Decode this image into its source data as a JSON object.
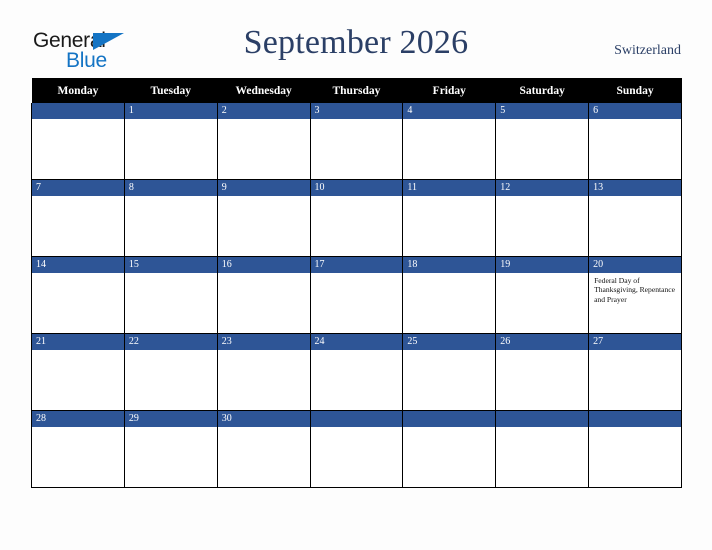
{
  "logo": {
    "text_primary": "General",
    "text_secondary": "Blue",
    "triangle_color": "#1474c4",
    "primary_color": "#1a1a1a"
  },
  "header": {
    "title": "September 2026",
    "country": "Switzerland",
    "title_color": "#2b3f66"
  },
  "calendar": {
    "weekday_headers": [
      "Monday",
      "Tuesday",
      "Wednesday",
      "Thursday",
      "Friday",
      "Saturday",
      "Sunday"
    ],
    "header_bg": "#000000",
    "date_bar_color": "#2e5596",
    "weeks": [
      [
        {
          "day": ""
        },
        {
          "day": "1"
        },
        {
          "day": "2"
        },
        {
          "day": "3"
        },
        {
          "day": "4"
        },
        {
          "day": "5"
        },
        {
          "day": "6"
        }
      ],
      [
        {
          "day": "7"
        },
        {
          "day": "8"
        },
        {
          "day": "9"
        },
        {
          "day": "10"
        },
        {
          "day": "11"
        },
        {
          "day": "12"
        },
        {
          "day": "13"
        }
      ],
      [
        {
          "day": "14"
        },
        {
          "day": "15"
        },
        {
          "day": "16"
        },
        {
          "day": "17"
        },
        {
          "day": "18"
        },
        {
          "day": "19"
        },
        {
          "day": "20",
          "event": "Federal Day of Thanksgiving, Repentance and Prayer"
        }
      ],
      [
        {
          "day": "21"
        },
        {
          "day": "22"
        },
        {
          "day": "23"
        },
        {
          "day": "24"
        },
        {
          "day": "25"
        },
        {
          "day": "26"
        },
        {
          "day": "27"
        }
      ],
      [
        {
          "day": "28"
        },
        {
          "day": "29"
        },
        {
          "day": "30"
        },
        {
          "day": ""
        },
        {
          "day": ""
        },
        {
          "day": ""
        },
        {
          "day": ""
        }
      ]
    ]
  }
}
